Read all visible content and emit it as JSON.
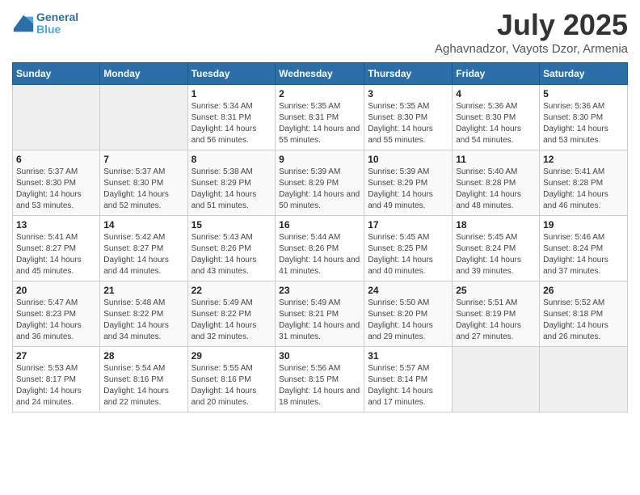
{
  "logo": {
    "name": "General",
    "name2": "Blue"
  },
  "title": "July 2025",
  "subtitle": "Aghavnadzor, Vayots Dzor, Armenia",
  "days_of_week": [
    "Sunday",
    "Monday",
    "Tuesday",
    "Wednesday",
    "Thursday",
    "Friday",
    "Saturday"
  ],
  "weeks": [
    [
      {
        "day": "",
        "info": ""
      },
      {
        "day": "",
        "info": ""
      },
      {
        "day": "1",
        "info": "Sunrise: 5:34 AM\nSunset: 8:31 PM\nDaylight: 14 hours and 56 minutes."
      },
      {
        "day": "2",
        "info": "Sunrise: 5:35 AM\nSunset: 8:31 PM\nDaylight: 14 hours and 55 minutes."
      },
      {
        "day": "3",
        "info": "Sunrise: 5:35 AM\nSunset: 8:30 PM\nDaylight: 14 hours and 55 minutes."
      },
      {
        "day": "4",
        "info": "Sunrise: 5:36 AM\nSunset: 8:30 PM\nDaylight: 14 hours and 54 minutes."
      },
      {
        "day": "5",
        "info": "Sunrise: 5:36 AM\nSunset: 8:30 PM\nDaylight: 14 hours and 53 minutes."
      }
    ],
    [
      {
        "day": "6",
        "info": "Sunrise: 5:37 AM\nSunset: 8:30 PM\nDaylight: 14 hours and 53 minutes."
      },
      {
        "day": "7",
        "info": "Sunrise: 5:37 AM\nSunset: 8:30 PM\nDaylight: 14 hours and 52 minutes."
      },
      {
        "day": "8",
        "info": "Sunrise: 5:38 AM\nSunset: 8:29 PM\nDaylight: 14 hours and 51 minutes."
      },
      {
        "day": "9",
        "info": "Sunrise: 5:39 AM\nSunset: 8:29 PM\nDaylight: 14 hours and 50 minutes."
      },
      {
        "day": "10",
        "info": "Sunrise: 5:39 AM\nSunset: 8:29 PM\nDaylight: 14 hours and 49 minutes."
      },
      {
        "day": "11",
        "info": "Sunrise: 5:40 AM\nSunset: 8:28 PM\nDaylight: 14 hours and 48 minutes."
      },
      {
        "day": "12",
        "info": "Sunrise: 5:41 AM\nSunset: 8:28 PM\nDaylight: 14 hours and 46 minutes."
      }
    ],
    [
      {
        "day": "13",
        "info": "Sunrise: 5:41 AM\nSunset: 8:27 PM\nDaylight: 14 hours and 45 minutes."
      },
      {
        "day": "14",
        "info": "Sunrise: 5:42 AM\nSunset: 8:27 PM\nDaylight: 14 hours and 44 minutes."
      },
      {
        "day": "15",
        "info": "Sunrise: 5:43 AM\nSunset: 8:26 PM\nDaylight: 14 hours and 43 minutes."
      },
      {
        "day": "16",
        "info": "Sunrise: 5:44 AM\nSunset: 8:26 PM\nDaylight: 14 hours and 41 minutes."
      },
      {
        "day": "17",
        "info": "Sunrise: 5:45 AM\nSunset: 8:25 PM\nDaylight: 14 hours and 40 minutes."
      },
      {
        "day": "18",
        "info": "Sunrise: 5:45 AM\nSunset: 8:24 PM\nDaylight: 14 hours and 39 minutes."
      },
      {
        "day": "19",
        "info": "Sunrise: 5:46 AM\nSunset: 8:24 PM\nDaylight: 14 hours and 37 minutes."
      }
    ],
    [
      {
        "day": "20",
        "info": "Sunrise: 5:47 AM\nSunset: 8:23 PM\nDaylight: 14 hours and 36 minutes."
      },
      {
        "day": "21",
        "info": "Sunrise: 5:48 AM\nSunset: 8:22 PM\nDaylight: 14 hours and 34 minutes."
      },
      {
        "day": "22",
        "info": "Sunrise: 5:49 AM\nSunset: 8:22 PM\nDaylight: 14 hours and 32 minutes."
      },
      {
        "day": "23",
        "info": "Sunrise: 5:49 AM\nSunset: 8:21 PM\nDaylight: 14 hours and 31 minutes."
      },
      {
        "day": "24",
        "info": "Sunrise: 5:50 AM\nSunset: 8:20 PM\nDaylight: 14 hours and 29 minutes."
      },
      {
        "day": "25",
        "info": "Sunrise: 5:51 AM\nSunset: 8:19 PM\nDaylight: 14 hours and 27 minutes."
      },
      {
        "day": "26",
        "info": "Sunrise: 5:52 AM\nSunset: 8:18 PM\nDaylight: 14 hours and 26 minutes."
      }
    ],
    [
      {
        "day": "27",
        "info": "Sunrise: 5:53 AM\nSunset: 8:17 PM\nDaylight: 14 hours and 24 minutes."
      },
      {
        "day": "28",
        "info": "Sunrise: 5:54 AM\nSunset: 8:16 PM\nDaylight: 14 hours and 22 minutes."
      },
      {
        "day": "29",
        "info": "Sunrise: 5:55 AM\nSunset: 8:16 PM\nDaylight: 14 hours and 20 minutes."
      },
      {
        "day": "30",
        "info": "Sunrise: 5:56 AM\nSunset: 8:15 PM\nDaylight: 14 hours and 18 minutes."
      },
      {
        "day": "31",
        "info": "Sunrise: 5:57 AM\nSunset: 8:14 PM\nDaylight: 14 hours and 17 minutes."
      },
      {
        "day": "",
        "info": ""
      },
      {
        "day": "",
        "info": ""
      }
    ]
  ]
}
